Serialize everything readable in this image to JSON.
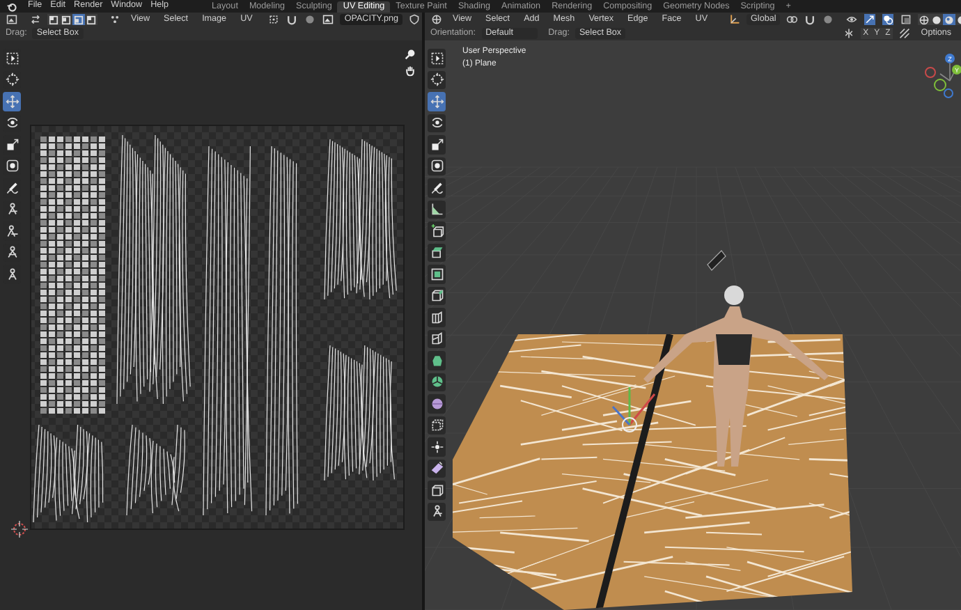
{
  "top_bar": {
    "menus": [
      "File",
      "Edit",
      "Render",
      "Window",
      "Help"
    ],
    "workspaces": [
      {
        "label": "Layout",
        "selected": false
      },
      {
        "label": "Modeling",
        "selected": false
      },
      {
        "label": "Sculpting",
        "selected": false
      },
      {
        "label": "UV Editing",
        "selected": true
      },
      {
        "label": "Texture Paint",
        "selected": false
      },
      {
        "label": "Shading",
        "selected": false
      },
      {
        "label": "Animation",
        "selected": false
      },
      {
        "label": "Rendering",
        "selected": false
      },
      {
        "label": "Compositing",
        "selected": false
      },
      {
        "label": "Geometry Nodes",
        "selected": false
      },
      {
        "label": "Scripting",
        "selected": false
      }
    ],
    "add_workspace": "+"
  },
  "uv_editor": {
    "select_modes": [
      {
        "selected": false
      },
      {
        "selected": false
      },
      {
        "selected": true
      },
      {
        "selected": false
      }
    ],
    "menus": [
      "View",
      "Select",
      "Image",
      "UV"
    ],
    "image_name": "OPACITY.png",
    "drag_label": "Drag:",
    "drag_value": "Select Box",
    "tools": [
      {
        "kind": "select",
        "selected": false
      },
      {
        "kind": "cursor",
        "selected": false
      },
      {
        "kind": "move",
        "selected": true
      },
      {
        "kind": "rotate",
        "selected": false
      },
      {
        "kind": "scale",
        "selected": false
      },
      {
        "kind": "transform",
        "selected": false
      },
      {
        "kind": "annotate",
        "selected": false
      },
      {
        "kind": "rip",
        "selected": false
      },
      {
        "kind": "grab",
        "selected": false
      },
      {
        "kind": "relax",
        "selected": false
      },
      {
        "kind": "pinch",
        "selected": false
      }
    ]
  },
  "viewport": {
    "menus": [
      "View",
      "Select",
      "Add",
      "Mesh",
      "Vertex",
      "Edge",
      "Face",
      "UV"
    ],
    "transform_orientation": "Global",
    "orientation_label": "Orientation:",
    "orientation_value": "Default",
    "drag_label": "Drag:",
    "drag_value": "Select Box",
    "axes": [
      "X",
      "Y",
      "Z"
    ],
    "options": "Options",
    "shading_modes": [
      {
        "selected": false
      },
      {
        "selected": false
      },
      {
        "selected": true
      },
      {
        "selected": false
      }
    ],
    "view_name": "User Perspective",
    "object_name": "(1) Plane",
    "gizmo_labels": [
      "Z",
      "Y"
    ],
    "tools": [
      {
        "kind": "select",
        "selected": false
      },
      {
        "kind": "cursor",
        "selected": false
      },
      {
        "kind": "move",
        "selected": true
      },
      {
        "kind": "rotate",
        "selected": false
      },
      {
        "kind": "scale",
        "selected": false
      },
      {
        "kind": "transform",
        "selected": false
      },
      {
        "kind": "annotate",
        "selected": false
      },
      {
        "kind": "measure",
        "selected": false
      },
      {
        "kind": "addcube",
        "selected": false
      },
      {
        "kind": "extrude",
        "selected": false
      },
      {
        "kind": "inset",
        "selected": false
      },
      {
        "kind": "bevel",
        "selected": false
      },
      {
        "kind": "loopcut",
        "selected": false
      },
      {
        "kind": "knife",
        "selected": false
      },
      {
        "kind": "polybuild",
        "selected": false
      },
      {
        "kind": "spin",
        "selected": false
      },
      {
        "kind": "smooth",
        "selected": false
      },
      {
        "kind": "randomize",
        "selected": false
      },
      {
        "kind": "shrink",
        "selected": false
      },
      {
        "kind": "shear",
        "selected": false
      },
      {
        "kind": "slide",
        "selected": false
      },
      {
        "kind": "rip",
        "selected": false
      }
    ]
  }
}
